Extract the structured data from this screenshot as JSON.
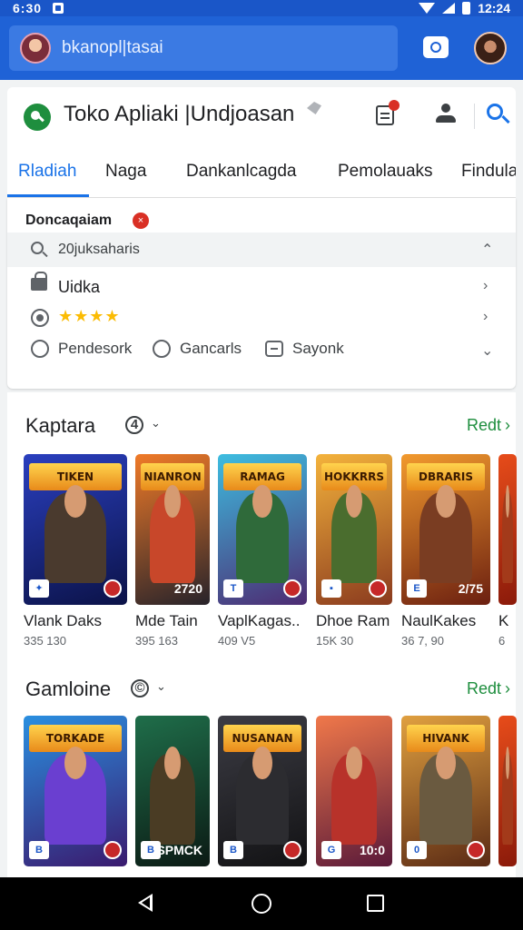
{
  "status_bar": {
    "time_left": "6:30",
    "time_right": "12:24"
  },
  "top_bar": {
    "search_text": "bkanopl|tasai"
  },
  "header": {
    "title": "Toko Apliaki |Undjoasan"
  },
  "tabs": [
    {
      "label": "Rladiah",
      "active": true
    },
    {
      "label": "Naga"
    },
    {
      "label": "Dankanlcagda"
    },
    {
      "label": "Pemolauaks"
    },
    {
      "label": "Findulals"
    }
  ],
  "filter": {
    "heading": "Doncaqaiam",
    "badge": "×",
    "search_value": "20juksaharis",
    "row1_label": "Uidka",
    "stars": "★★★★",
    "options": [
      "Pendesork",
      "Gancarls",
      "Sayonk"
    ]
  },
  "sections": [
    {
      "title": "Kaptara",
      "badge": "4",
      "more_label": "Redt",
      "items": [
        {
          "name": "Vlank Daks",
          "meta": "335 130",
          "banner": "TIKEN",
          "bg1": "#2a3fbf",
          "bg2": "#0b1247",
          "hero": "#4a3a2e",
          "badge_left": "✦",
          "corner": ""
        },
        {
          "name": "Mde Tain",
          "meta": "395 163",
          "banner": "NIANRON",
          "bg1": "#f07a28",
          "bg2": "#27232a",
          "hero": "#c8472a",
          "badge_left": "",
          "corner": "2720"
        },
        {
          "name": "VaplKagas..",
          "meta": "409 V5",
          "banner": "RAMAG",
          "bg1": "#3dbde0",
          "bg2": "#4d2b72",
          "hero": "#2f6a3a",
          "badge_left": "T",
          "corner": ""
        },
        {
          "name": "Dhoe Ram",
          "meta": "15K 30",
          "banner": "HOKKRRS",
          "bg1": "#f4b33c",
          "bg2": "#8a3a1e",
          "hero": "#4a6d2e",
          "badge_left": "▪",
          "corner": ""
        },
        {
          "name": "NaulKakes",
          "meta": "36 7, 90",
          "banner": "DBRARIS",
          "bg1": "#f29a2e",
          "bg2": "#6b1f10",
          "hero": "#7a3d22",
          "badge_left": "E",
          "corner": "2/75"
        },
        {
          "name": "K",
          "meta": "6",
          "banner": "",
          "bg1": "#e74c1a",
          "bg2": "#8b1a0a",
          "hero": "#a33a1a",
          "badge_left": "",
          "corner": ""
        }
      ]
    },
    {
      "title": "Gamloine",
      "badge": "©",
      "more_label": "Redt",
      "items": [
        {
          "name": "",
          "meta": "",
          "banner": "TORKADE",
          "bg1": "#2a8fe0",
          "bg2": "#3a1a6e",
          "hero": "#6a3fd0",
          "badge_left": "B",
          "corner": ""
        },
        {
          "name": "",
          "meta": "",
          "banner": "",
          "bg1": "#1f6e4a",
          "bg2": "#0b1a14",
          "hero": "#4a3c24",
          "badge_left": "B",
          "corner": "SPMCK"
        },
        {
          "name": "",
          "meta": "",
          "banner": "NUSANAN",
          "bg1": "#3c3c44",
          "bg2": "#121214",
          "hero": "#2c2c30",
          "badge_left": "B",
          "corner": ""
        },
        {
          "name": "",
          "meta": "",
          "banner": "",
          "bg1": "#f0784a",
          "bg2": "#5a1a3a",
          "hero": "#b8322a",
          "badge_left": "G",
          "corner": "10:0"
        },
        {
          "name": "",
          "meta": "",
          "banner": "HIVANK",
          "bg1": "#e0a040",
          "bg2": "#5a2a14",
          "hero": "#6a5a40",
          "badge_left": "0",
          "corner": ""
        },
        {
          "name": "",
          "meta": "",
          "banner": "",
          "bg1": "#e74c1a",
          "bg2": "#8b1a0a",
          "hero": "#a33a1a",
          "badge_left": "",
          "corner": ""
        }
      ]
    }
  ],
  "colors": {
    "primary": "#1f62d6",
    "accent": "#1a73e8",
    "more": "#1e8e3e",
    "star": "#fbbc04"
  },
  "nav": {
    "back": "back-icon",
    "home": "home-icon",
    "recent": "recent-apps-icon"
  }
}
